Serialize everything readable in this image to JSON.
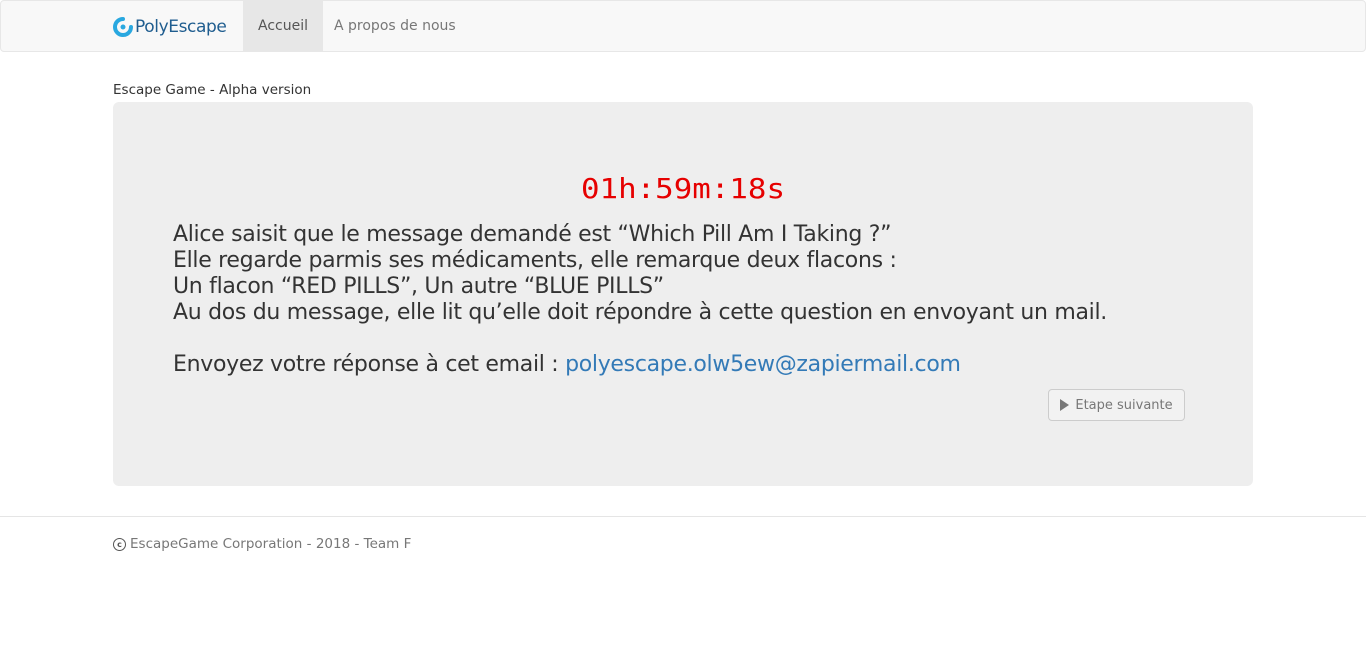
{
  "navbar": {
    "brand": "PolyEscape",
    "items": [
      {
        "label": "Accueil",
        "active": true
      },
      {
        "label": "A propos de nous",
        "active": false
      }
    ],
    "brand_color": "#1f5d8f",
    "logo_color": "#29a8e0"
  },
  "main": {
    "subtitle": "Escape Game - Alpha version",
    "timer": "01h:59m:18s",
    "timer_color": "#e60000",
    "message_lines": [
      "Alice saisit que le message demandé est “Which Pill Am I Taking ?”",
      "Elle regarde parmis ses médicaments, elle remarque deux flacons :",
      "Un flacon “RED PILLS”, Un autre “BLUE PILLS”",
      "Au dos du message, elle lit qu’elle doit répondre à cette question en envoyant un mail."
    ],
    "email_prompt": "Envoyez votre réponse à cet email : ",
    "email": "polyescape.olw5ew@zapiermail.com",
    "next_button": "Etape suivante",
    "link_color": "#337ab7"
  },
  "footer": {
    "copyright_symbol": "c",
    "text": "EscapeGame Corporation - 2018 - Team F"
  }
}
